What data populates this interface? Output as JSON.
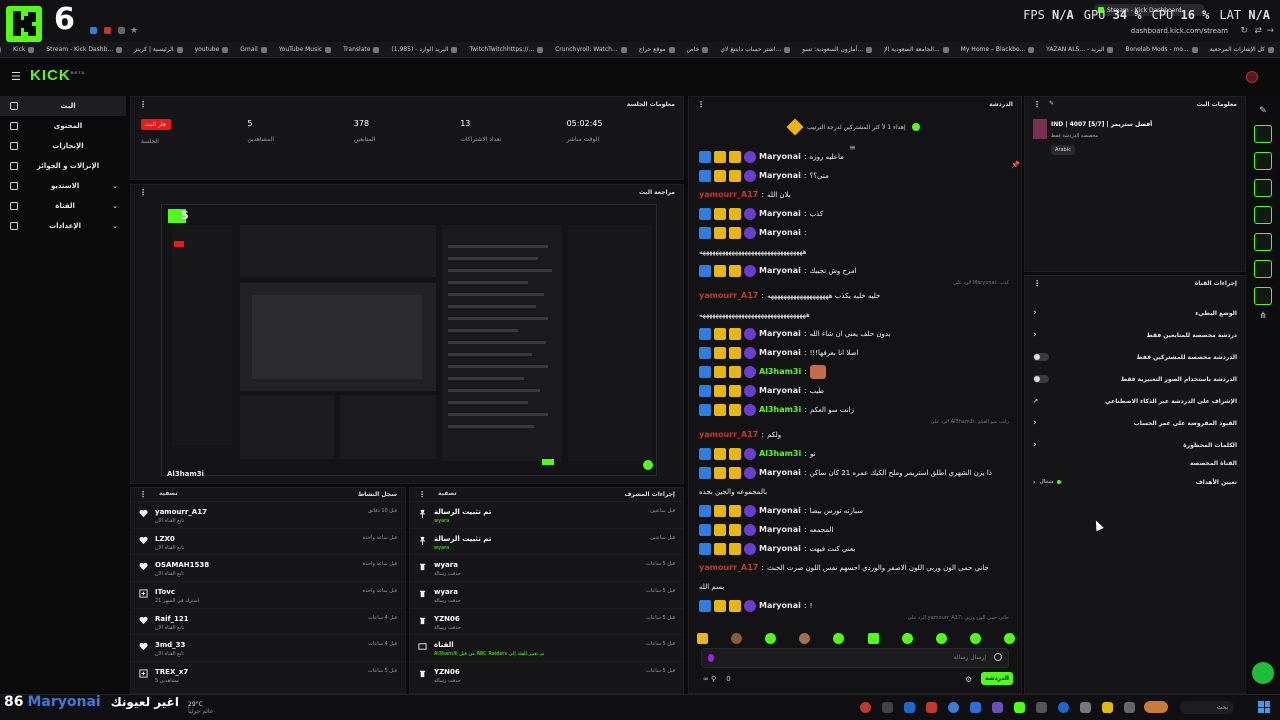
{
  "browser": {
    "overlay_number": "6",
    "stats": {
      "fps_label": "FPS",
      "fps": "N/A",
      "gpu_label": "GPU",
      "gpu": "34 %",
      "cpu_label": "CPU",
      "cpu": "16 %",
      "lat_label": "LAT",
      "lat": "N/A"
    },
    "active_tab": "Stream - Kick Dashboard",
    "address": "dashboard.kick.com/stream",
    "bookmarks": [
      "كل الإشارات المرجعية",
      "Bonelab Mods - mo...",
      "YAZAN ALS... - البريد",
      "My Home – Blackbo...",
      "الجامعة السعودية الإ...",
      "أمازون السعودية: تسو...",
      "اشتر حساب دايتنغ لاي...",
      "خاص",
      "موقع حراج",
      "Crunchyroll: Watch...",
      "TwitchTwitchhttps://...",
      "البريد الوارد - (1,985)",
      "Translate",
      "YouTube Music",
      "Gmail",
      "youtube",
      "الرئيسية | كرينز",
      "Stream - Kick Dashb...",
      "Kick",
      "Google"
    ]
  },
  "kick": {
    "logo": "KICK",
    "logo_sup": "BETA"
  },
  "sidenav": {
    "items": [
      {
        "label": "البث",
        "active": true
      },
      {
        "label": "المحتوى"
      },
      {
        "label": "الإنجازات"
      },
      {
        "label": "الإنزالات و الجوائز"
      },
      {
        "label": "الاستديو",
        "expand": true
      },
      {
        "label": "القناة",
        "expand": true
      },
      {
        "label": "الإعدادات",
        "expand": true
      }
    ]
  },
  "session": {
    "title": "معلومات الجلسة",
    "stats": [
      {
        "value": "05:02:45",
        "label": "الوقت مباشر"
      },
      {
        "value": "13",
        "label": "تعداد الاشتراكات"
      },
      {
        "value": "378",
        "label": "المتابعين"
      },
      {
        "value": "5",
        "label": "المشاهدين"
      },
      {
        "value": "جار البث",
        "label": "الجلسة",
        "badge": true
      }
    ]
  },
  "preview": {
    "title": "مراجعة البث",
    "overlay_name": "Al3ham3i",
    "overlay_num": "5"
  },
  "chat": {
    "title": "الدردشة",
    "pinned": "إهداء 1 لأ كثر المشتركين لدرجة الترتيب",
    "messages": [
      {
        "user": "Maryonai",
        "color": "#e6e6e6",
        "text": "ماعليه روزه",
        "badges": true
      },
      {
        "user": "Maryonai",
        "color": "#e6e6e6",
        "text": "متى؟؟",
        "badges": true
      },
      {
        "user": "yamourr_A17",
        "color": "#c0392b",
        "text": "بلان الله",
        "badges": false
      },
      {
        "user": "Maryonai",
        "color": "#e6e6e6",
        "text": "كذب",
        "badges": true
      },
      {
        "user": "Maryonai",
        "color": "#e6e6e6",
        "text": "",
        "badges": true
      },
      {
        "user": "",
        "color": "#e6e6e6",
        "text": "ههههههههههههههههههههههههههههههههه",
        "badges": false
      },
      {
        "user": "Maryonai",
        "color": "#e6e6e6",
        "text": "امزح وش تجيبك",
        "badges": true
      },
      {
        "user": "yamourr_A17",
        "color": "#c0392b",
        "text": "خليه خليه يكذب هههههههههههههههههههه",
        "badges": false,
        "reply": "الرد على Maryonai: كذب"
      },
      {
        "user": "",
        "color": "#e6e6e6",
        "text": "هههههههههههههههههههههههههههههههههه",
        "badges": false
      },
      {
        "user": "Maryonai",
        "color": "#e6e6e6",
        "text": "بدون حلف يعني ان شاء الله",
        "badges": true
      },
      {
        "user": "Maryonai",
        "color": "#e6e6e6",
        "text": "اصلا انا بعرفها!!!",
        "badges": true
      },
      {
        "user": "Al3ham3i",
        "color": "#53fc18",
        "text": "",
        "badges": true,
        "emote": true
      },
      {
        "user": "Maryonai",
        "color": "#e6e6e6",
        "text": "طيب",
        "badges": true
      },
      {
        "user": "Al3ham3i",
        "color": "#53fc18",
        "text": "زانت سو العكم",
        "badges": true
      },
      {
        "user": "yamourr_A17",
        "color": "#c0392b",
        "text": "ولكم",
        "badges": false,
        "reply": "الرد على Al3ham3i: زانت سو العكم"
      },
      {
        "user": "Al3ham3i",
        "color": "#53fc18",
        "text": "تو",
        "badges": true
      },
      {
        "user": "Maryonai",
        "color": "#e6e6e6",
        "text": "ذا يزن الشهري اطلق استريمر وملح الكيك عمره 21 كان ساكن",
        "badges": true
      },
      {
        "user": "",
        "color": "#e6e6e6",
        "text": "بالمجموعه والجين بجده",
        "badges": false
      },
      {
        "user": "Maryonai",
        "color": "#e6e6e6",
        "text": "سيارته تورس بيضا",
        "badges": true
      },
      {
        "user": "Maryonai",
        "color": "#e6e6e6",
        "text": "المجمعه",
        "badges": true
      },
      {
        "user": "Maryonai",
        "color": "#e6e6e6",
        "text": "يعني كنت فيهت",
        "badges": true
      },
      {
        "user": "yamourr_A17",
        "color": "#c0392b",
        "text": "جاني حمى الون وربي اللون الاصفر والوردي احسهم نفس اللون صرت الخبث",
        "badges": false
      },
      {
        "user": "",
        "color": "#e6e6e6",
        "text": "بسم الله",
        "badges": false
      },
      {
        "user": "Maryonai",
        "color": "#e6e6e6",
        "text": "!",
        "badges": true
      },
      {
        "user": "Maryonai",
        "color": "#e6e6e6",
        "text": "اغير لعيونك",
        "badges": true,
        "reply": "الرد على yamourr_A17: جاني حمى الون وربي"
      }
    ],
    "input_placeholder": "إرسال رسالة",
    "send_label": "الدردشة",
    "footer_count": "0"
  },
  "stream_info": {
    "title": "معلومات البث",
    "stream_title": "IND | 4007 [5/7] | أفضل ستريمر",
    "category": "مخصصة الدردشة فقط",
    "language": "Arabic"
  },
  "channel_actions": {
    "title": "إجراءات القناة",
    "items": [
      {
        "label": "الوضع البطيء",
        "control": "chevron"
      },
      {
        "label": "دردشة مخصصة للمتابعين فقط",
        "control": "chevron"
      },
      {
        "label": "الدردشة مخصصة للمشتركين فقط",
        "control": "toggle"
      },
      {
        "label": "الدردشة باستخدام الصور التعبيرية فقط",
        "control": "toggle"
      },
      {
        "label": "الإشراف على الدردشة عبر الذكاء الاصطناعي",
        "control": "link"
      },
      {
        "label": "القيود المفروضة على عمر الحساب",
        "control": "chevron"
      },
      {
        "label": "الكلمات المحظورة",
        "control": "chevron"
      }
    ],
    "section_label": "القناة المخصصة",
    "goal_label": "تعيين الأهداف",
    "goal_status": "شغال"
  },
  "activity": {
    "title": "سجل النشاط",
    "filter": "تصفية",
    "rows": [
      {
        "name": "yamourr_A17",
        "sub": "تابع القناة الآن",
        "time": "قبل 10 دقائق",
        "icon": "heart"
      },
      {
        "name": "LZX0",
        "sub": "تابع القناة الآن",
        "time": "قبل ساعة واحدة",
        "icon": "heart"
      },
      {
        "name": "OSAMAH1538",
        "sub": "تابع القناة الآن",
        "time": "قبل ساعة واحدة",
        "icon": "heart"
      },
      {
        "name": "ITovc",
        "sub": "21 اشترك في الشهر",
        "time": "قبل ساعة واحدة",
        "icon": "sub"
      },
      {
        "name": "Raif_121",
        "sub": "تابع القناة الآن",
        "time": "قبل 4 ساعات",
        "icon": "heart"
      },
      {
        "name": "3md_33",
        "sub": "تابع القناة الآن",
        "time": "قبل 4 ساعات",
        "icon": "heart"
      },
      {
        "name": "TREX_x7",
        "sub": "5 مشاهدين",
        "time": "قبل 5 ساعات",
        "icon": "sub"
      }
    ]
  },
  "modactions": {
    "title": "إجراءات المشرف",
    "filter": "تصفية",
    "rows": [
      {
        "name": "تم تثبيت الرسالة",
        "sub": "wyara",
        "time": "قبل ساعتين",
        "icon": "pin"
      },
      {
        "name": "تم تثبيت الرسالة",
        "sub": "wyara",
        "time": "قبل ساعتين",
        "icon": "pin"
      },
      {
        "name": "wyara",
        "sub": "حذفت رسالة",
        "time": "قبل 5 ساعات",
        "icon": "trash"
      },
      {
        "name": "wyara",
        "sub": "حذفت رسالة",
        "time": "قبل 5 ساعات",
        "icon": "trash"
      },
      {
        "name": "YZN06",
        "sub": "حذفت رسالة",
        "time": "قبل 5 ساعات",
        "icon": "trash"
      },
      {
        "name": "القناة",
        "sub": "Al3ham3i من قبل ARC Raiders تم تغيير الفئة إلى",
        "time": "قبل 5 ساعات",
        "icon": "box"
      },
      {
        "name": "YZN06",
        "sub": "حذفت رسالة",
        "time": "قبل 5 ساعات",
        "icon": "trash"
      }
    ]
  },
  "overlay_bottom": {
    "num": "86",
    "name": "Maryonai",
    "text": "اغير لعيونك"
  },
  "taskbar": {
    "weather": "29°C",
    "weather_sub": "غائم جزئياً",
    "search": "بحث"
  },
  "colors": {
    "brand": "#53fc18",
    "live": "#e91916",
    "panel": "#161618"
  }
}
